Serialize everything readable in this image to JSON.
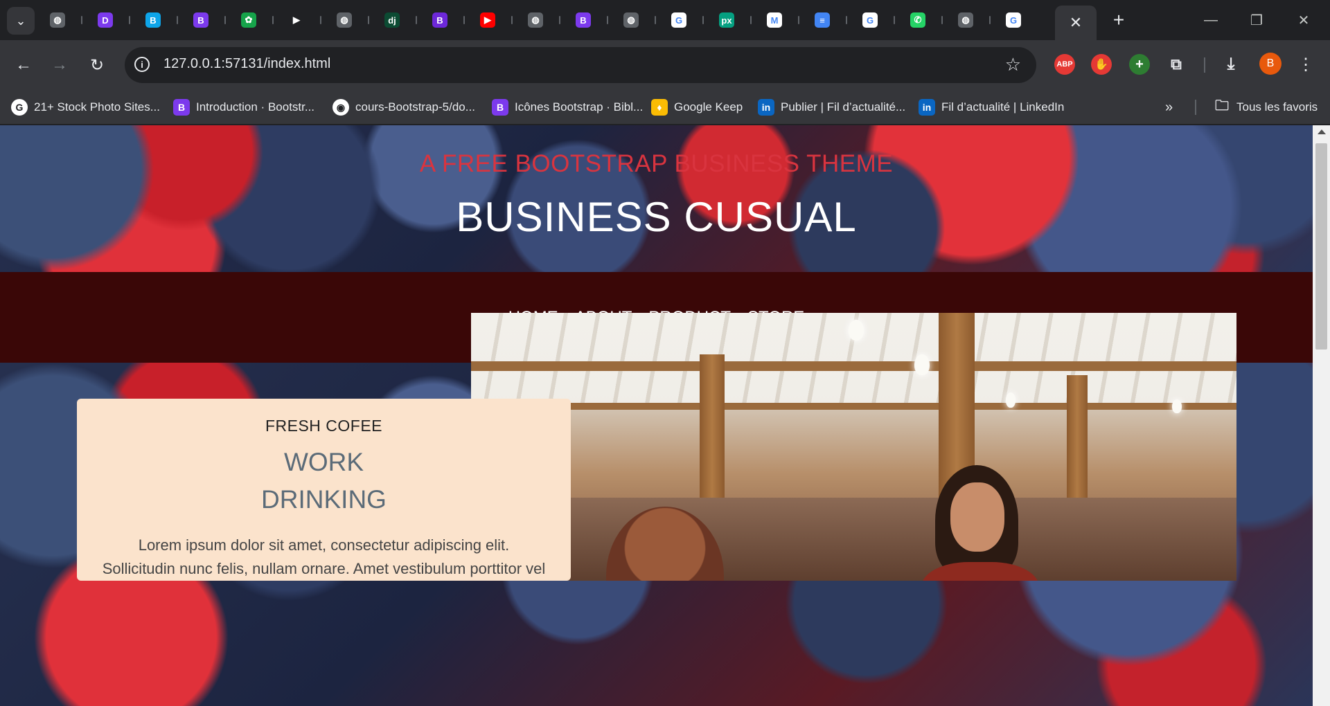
{
  "browser": {
    "tabs": [
      {
        "icon": "globe-icon",
        "color": "#5f6368",
        "glyph": "◍"
      },
      {
        "icon": "dotfolio-icon",
        "color": "#7c3aed",
        "glyph": "D"
      },
      {
        "icon": "bootstrap-icon",
        "color": "#0ea5e9",
        "glyph": "B"
      },
      {
        "icon": "bootstrap-icon",
        "color": "#7c3aed",
        "glyph": "B"
      },
      {
        "icon": "leaf-icon",
        "color": "#16a34a",
        "glyph": "✿"
      },
      {
        "icon": "play-icon",
        "color": "#202124",
        "glyph": "▶"
      },
      {
        "icon": "globe-icon",
        "color": "#5f6368",
        "glyph": "◍"
      },
      {
        "icon": "django-icon",
        "color": "#0c4b33",
        "glyph": "dj"
      },
      {
        "icon": "bootstrap-icon",
        "color": "#6d28d9",
        "glyph": "B"
      },
      {
        "icon": "youtube-icon",
        "color": "#ff0000",
        "glyph": "▶"
      },
      {
        "icon": "globe-icon",
        "color": "#5f6368",
        "glyph": "◍"
      },
      {
        "icon": "bootstrap-icon",
        "color": "#7c3aed",
        "glyph": "B"
      },
      {
        "icon": "globe-icon",
        "color": "#5f6368",
        "glyph": "◍"
      },
      {
        "icon": "google-icon",
        "color": "#ffffff",
        "glyph": "G"
      },
      {
        "icon": "pexels-icon",
        "color": "#05a081",
        "glyph": "px"
      },
      {
        "icon": "gmail-icon",
        "color": "#ffffff",
        "glyph": "M"
      },
      {
        "icon": "docs-icon",
        "color": "#4285f4",
        "glyph": "≡"
      },
      {
        "icon": "google-icon",
        "color": "#ffffff",
        "glyph": "G"
      },
      {
        "icon": "whatsapp-icon",
        "color": "#25d366",
        "glyph": "✆"
      },
      {
        "icon": "globe-icon",
        "color": "#5f6368",
        "glyph": "◍"
      },
      {
        "icon": "google-icon",
        "color": "#ffffff",
        "glyph": "G"
      }
    ],
    "url": "127.0.0.1:57131/index.html",
    "avatar_initial": "B",
    "bookmarks": [
      {
        "label": "21+ Stock Photo Sites...",
        "icon": "google-icon",
        "color": "#ffffff",
        "glyph": "G"
      },
      {
        "label": "Introduction · Bootstr...",
        "icon": "bootstrap-icon",
        "color": "#7c3aed",
        "glyph": "B"
      },
      {
        "label": "cours-Bootstrap-5/do...",
        "icon": "github-icon",
        "color": "#ffffff",
        "glyph": "◉"
      },
      {
        "label": "Icônes Bootstrap · Bibl...",
        "icon": "bootstrap-icon",
        "color": "#7c3aed",
        "glyph": "B"
      },
      {
        "label": "Google Keep",
        "icon": "keep-icon",
        "color": "#fbbc04",
        "glyph": "♦"
      },
      {
        "label": "Publier | Fil d’actualité...",
        "icon": "linkedin-icon",
        "color": "#0a66c2",
        "glyph": "in"
      },
      {
        "label": "Fil d’actualité | LinkedIn",
        "icon": "linkedin-icon",
        "color": "#0a66c2",
        "glyph": "in"
      }
    ],
    "all_bookmarks_label": "Tous les favoris"
  },
  "page": {
    "hero_subtitle": "A FREE BOOTSTRAP BUSINESS THEME",
    "hero_title": "BUSINESS CUSUAL",
    "nav": [
      "HOME",
      "ABOUT",
      "PRODUCT",
      "STORE"
    ],
    "card": {
      "kicker": "FRESH COFEE",
      "title_line1": "WORK",
      "title_line2": "DRINKING",
      "text_line1": "Lorem ipsum dolor sit amet, consectetur adipiscing elit.",
      "text_line2": "Sollicitudin nunc felis, nullam ornare. Amet vestibulum porttitor vel"
    }
  }
}
